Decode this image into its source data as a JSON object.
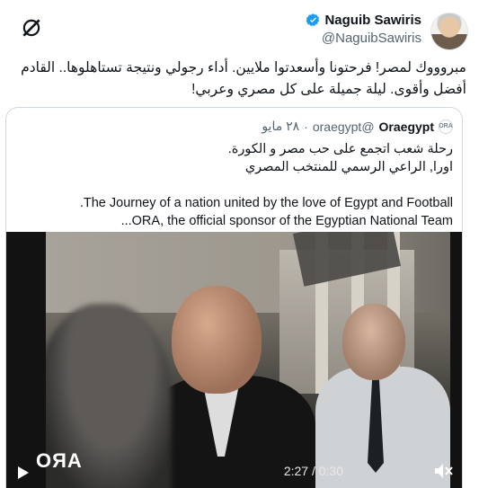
{
  "author": {
    "display_name": "Naguib Sawiris",
    "handle": "@NaguibSawiris"
  },
  "tweet": {
    "text": "مبروووك لمصر! فرحتونا وأسعدتوا ملايين. أداء رجولي ونتيجة تستاهلوها.. القادم أفضل وأقوى. ليلة جميلة على كل مصري وعربي!"
  },
  "quote": {
    "name": "Oraegypt",
    "handle": "@oraegypt",
    "separator": "·",
    "date": "٢٨ مايو",
    "logo_text": "ORA",
    "lines_ar": [
      "رحلة شعب اتجمع على حب مصر و الكورة.",
      "اورا, الراعي الرسمي للمنتخب المصري"
    ],
    "lines_en": [
      "The Journey of a nation united by the love of Egypt and Football.",
      "ORA, the official sponsor of the Egyptian National Team..."
    ],
    "video": {
      "overlay_logo": "OЯA",
      "time": "2:27 / 0:30"
    }
  },
  "colors": {
    "verified": "#1d9bf0",
    "text_primary": "#0f1419",
    "text_secondary": "#536471",
    "border": "#cfd9de"
  },
  "icons": [
    "verified-badge-icon",
    "x-logo-icon",
    "play-icon",
    "mute-icon"
  ]
}
